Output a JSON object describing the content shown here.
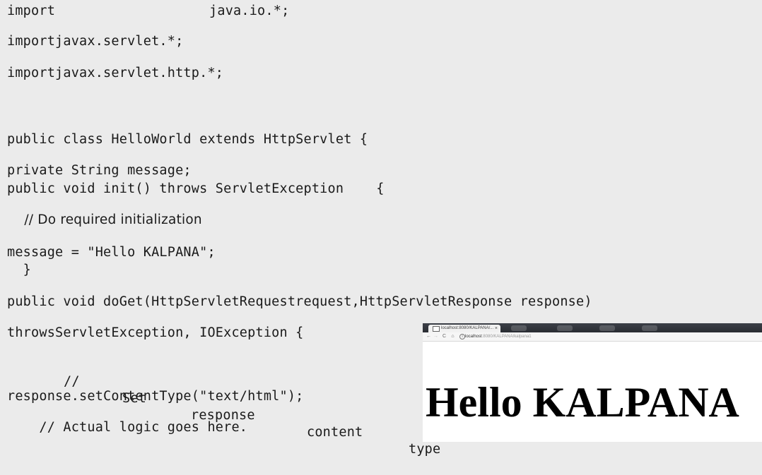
{
  "code_lines": [
    {
      "text": "import",
      "text_b": "java.io.*;"
    },
    "importjavax.servlet.*;",
    "importjavax.servlet.http.*;",
    "public class HelloWorld extends HttpServlet {",
    "private String message;",
    "public void init() throws ServletException",
    "    // Do required initialization",
    "message = \"Hello KALPANA\";",
    "  }",
    "public void doGet(HttpServletRequestrequest,HttpServletResponse response)",
    "throwsServletException, IOException {",
    {
      "comment": "//",
      "words": [
        "Set",
        "response",
        "content",
        "type"
      ]
    },
    "response.setContentType(\"text/html\");",
    "    // Actual logic goes here."
  ],
  "init_brace": "{",
  "browser": {
    "tab_title": "localhost:8080/KALPANA/...",
    "tab_close": "×",
    "nav_back": "←",
    "nav_forward": "→",
    "nav_reload": "C",
    "nav_home": "⌂",
    "info_icon": "i",
    "url_host": "localhost",
    "url_path": ":8080/KALPANA/kalpana1",
    "heading": "Hello KALPANA"
  }
}
